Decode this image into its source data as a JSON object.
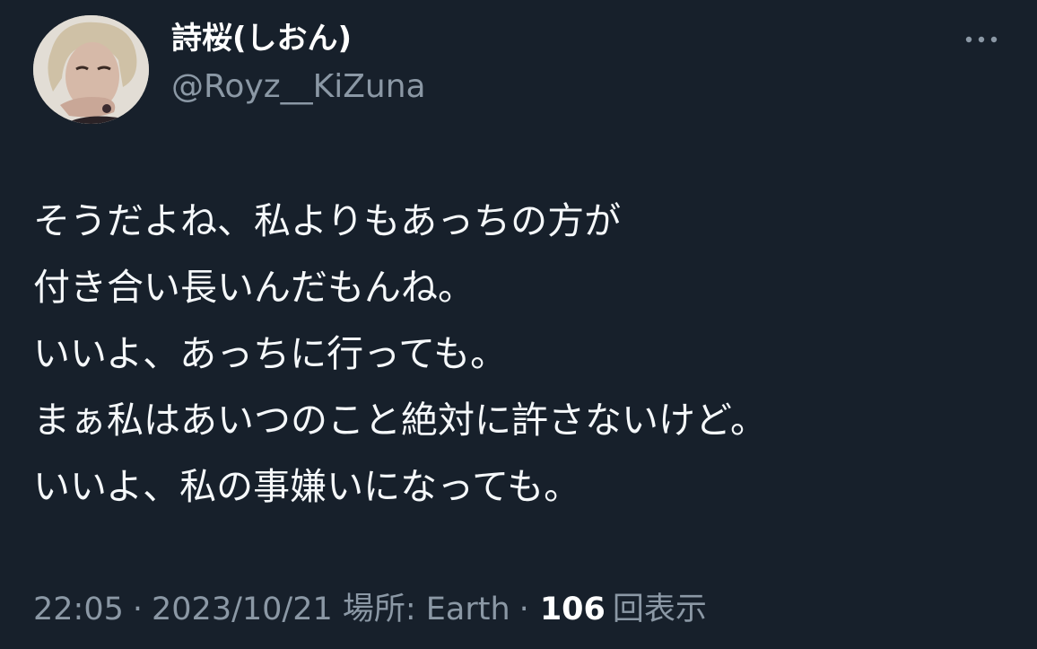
{
  "author": {
    "display_name": "詩桜(しおん)",
    "handle": "@Royz__KiZuna",
    "avatar_icon": "profile-photo"
  },
  "header": {
    "more_icon": "more-horizontal-icon"
  },
  "tweet": {
    "lines": [
      "そうだよね、私よりもあっちの方が",
      "付き合い長いんだもんね。",
      "いいよ、あっちに行っても。",
      "まぁ私はあいつのこと絶対に許さないけど。",
      "いいよ、私の事嫌いになっても。"
    ]
  },
  "meta": {
    "time": "22:05",
    "separator": "·",
    "date": "2023/10/21",
    "location": "場所: Earth",
    "views_count": "106",
    "views_label": "回表示"
  },
  "colors": {
    "background": "#17202b",
    "primary_text": "#f5f8fa",
    "secondary_text": "#8b98a5"
  }
}
